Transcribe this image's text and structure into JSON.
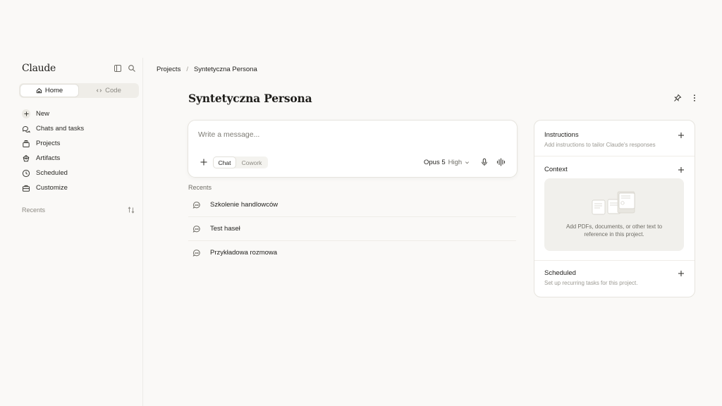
{
  "sidebar": {
    "logo": "Claude",
    "toggle_icon": "sidebar-toggle-icon",
    "search_icon": "search-icon",
    "segments": {
      "home": "Home",
      "code": "Code"
    },
    "nav": [
      {
        "label": "New",
        "icon": "plus-icon"
      },
      {
        "label": "Chats and tasks",
        "icon": "chats-icon"
      },
      {
        "label": "Projects",
        "icon": "projects-icon"
      },
      {
        "label": "Artifacts",
        "icon": "artifacts-icon"
      },
      {
        "label": "Scheduled",
        "icon": "clock-icon"
      },
      {
        "label": "Customize",
        "icon": "briefcase-icon"
      }
    ],
    "recents_label": "Recents"
  },
  "breadcrumb": {
    "root": "Projects",
    "separator": "/",
    "current": "Syntetyczna Persona"
  },
  "project": {
    "title": "Syntetyczna Persona"
  },
  "composer": {
    "placeholder": "Write a message...",
    "mode_chat": "Chat",
    "mode_cowork": "Cowork",
    "model": "Opus 5",
    "effort": "High"
  },
  "recents": {
    "label": "Recents",
    "items": [
      "Szkolenie handlowców",
      "Test haseł",
      "Przykładowa rozmowa"
    ]
  },
  "panel": {
    "instructions": {
      "title": "Instructions",
      "desc": "Add instructions to tailor Claude's responses"
    },
    "context": {
      "title": "Context",
      "dropzone_line1": "Add PDFs, documents, or other text to",
      "dropzone_line2": "reference in this project."
    },
    "scheduled": {
      "title": "Scheduled",
      "desc": "Set up recurring tasks for this project."
    }
  },
  "colors": {
    "background": "#faf9f7",
    "surface": "#ffffff",
    "border": "#e6e4de",
    "text": "#1f1e1b",
    "muted": "#8c8a83"
  }
}
